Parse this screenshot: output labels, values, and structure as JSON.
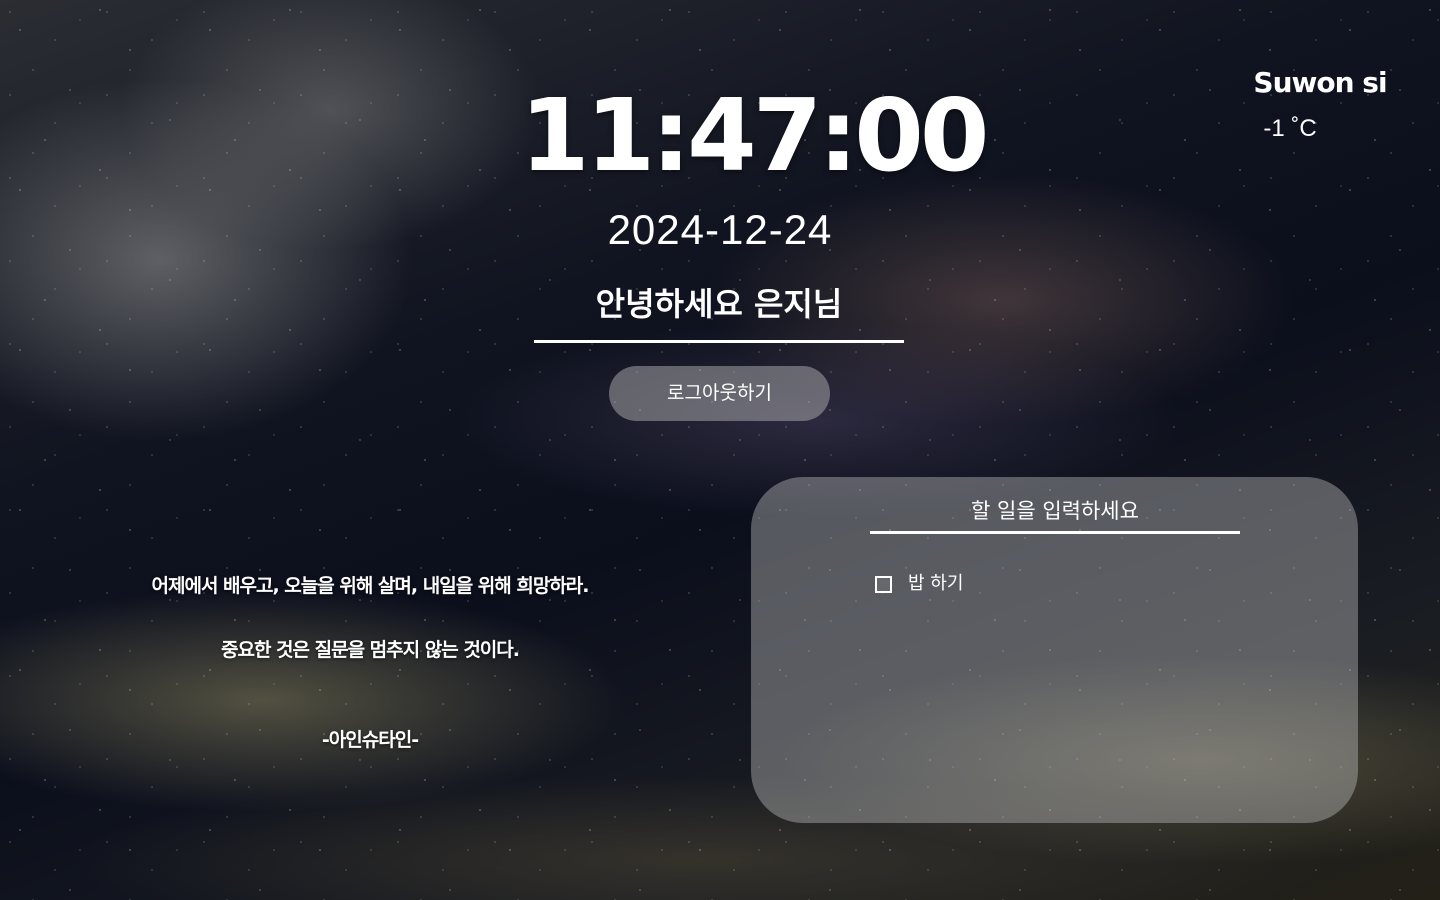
{
  "clock": {
    "time": "11:47:00",
    "date": "2024-12-24"
  },
  "greeting": {
    "text": "안녕하세요 은지님"
  },
  "auth": {
    "logout_label": "로그아웃하기"
  },
  "weather": {
    "city": "Suwon si",
    "temperature": "-1 ˚C"
  },
  "quote": {
    "line1": "어제에서 배우고, 오늘을 위해 살며, 내일을 위해 희망하라.",
    "line2": "중요한 것은 질문을 멈추지 않는 것이다.",
    "author": "-아인슈타인-"
  },
  "todo": {
    "placeholder": "할 일을 입력하세요",
    "items": [
      {
        "label": "밥 하기",
        "checked": false
      }
    ]
  }
}
